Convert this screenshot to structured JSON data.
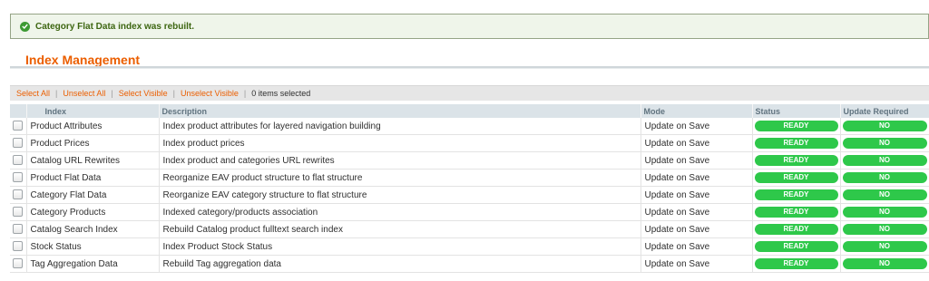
{
  "message": {
    "icon": "check-circle-icon",
    "text": "Category Flat Data index was rebuilt."
  },
  "page_title": "Index Management",
  "toolbar": {
    "select_all": "Select All",
    "unselect_all": "Unselect All",
    "select_visible": "Select Visible",
    "unselect_visible": "Unselect Visible",
    "separator": "|",
    "items_selected": "0 items selected"
  },
  "table": {
    "columns": [
      "",
      "Index",
      "Description",
      "Mode",
      "Status",
      "Update Required"
    ],
    "rows": [
      {
        "index": "Product Attributes",
        "description": "Index product attributes for layered navigation building",
        "mode": "Update on Save",
        "status": "READY",
        "update_required": "NO"
      },
      {
        "index": "Product Prices",
        "description": "Index product prices",
        "mode": "Update on Save",
        "status": "READY",
        "update_required": "NO"
      },
      {
        "index": "Catalog URL Rewrites",
        "description": "Index product and categories URL rewrites",
        "mode": "Update on Save",
        "status": "READY",
        "update_required": "NO"
      },
      {
        "index": "Product Flat Data",
        "description": "Reorganize EAV product structure to flat structure",
        "mode": "Update on Save",
        "status": "READY",
        "update_required": "NO"
      },
      {
        "index": "Category Flat Data",
        "description": "Reorganize EAV category structure to flat structure",
        "mode": "Update on Save",
        "status": "READY",
        "update_required": "NO"
      },
      {
        "index": "Category Products",
        "description": "Indexed category/products association",
        "mode": "Update on Save",
        "status": "READY",
        "update_required": "NO"
      },
      {
        "index": "Catalog Search Index",
        "description": "Rebuild Catalog product fulltext search index",
        "mode": "Update on Save",
        "status": "READY",
        "update_required": "NO"
      },
      {
        "index": "Stock Status",
        "description": "Index Product Stock Status",
        "mode": "Update on Save",
        "status": "READY",
        "update_required": "NO"
      },
      {
        "index": "Tag Aggregation Data",
        "description": "Rebuild Tag aggregation data",
        "mode": "Update on Save",
        "status": "READY",
        "update_required": "NO"
      }
    ]
  },
  "colors": {
    "accent": "#eb5e00",
    "success_badge": "#2ec84a",
    "message_bg": "#eff5ea",
    "header_bg": "#dbe3e8"
  }
}
